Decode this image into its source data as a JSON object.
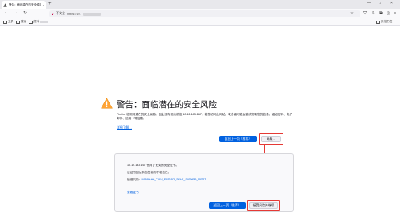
{
  "tab": {
    "title": "警告：面临潜在的安全风险",
    "close": "×",
    "new_tab": "+"
  },
  "window": {
    "minimize": "—",
    "maximize": "□",
    "close": "×"
  },
  "toolbar": {
    "back": "←",
    "forward": "→",
    "reload": "↻",
    "insecure_label": "不安全",
    "url": "https://10.",
    "icons": {
      "bookmark": "☆",
      "pocket": "⛉",
      "downloads": "⇩",
      "extensions": "⧉",
      "account": "◎",
      "menu": "≡"
    }
  },
  "bookmarks": {
    "items": [
      "工具",
      "搜索",
      "资料"
    ],
    "other": "其他书签"
  },
  "warning": {
    "title": "警告：面临潜在的安全风险",
    "description": "Firefox 检测到潜在的安全威胁，因此没有继续前往 10.12.183.167。若您访问此网站，攻击者可能会尝试窃取您的信息，诸如密码、电子邮件、信用卡等信息。",
    "learn_more": "详细了解…",
    "go_back": "返回上一页（推荐）",
    "advanced": "高级…"
  },
  "advanced": {
    "line1": "10.12.183.167 使用了无效的安全证书。",
    "line2": "该证书因为其自签名而不被信任。",
    "error_label": "错误代码：",
    "error_code": "MOZILLA_PKIX_ERROR_SELF_SIGNED_CERT",
    "view_cert": "查看证书",
    "go_back": "返回上一页（推荐）",
    "accept": "接受风险并继续"
  },
  "colors": {
    "accent": "#0061e0",
    "annotation": "#e53935",
    "warning": "#ffa436"
  }
}
